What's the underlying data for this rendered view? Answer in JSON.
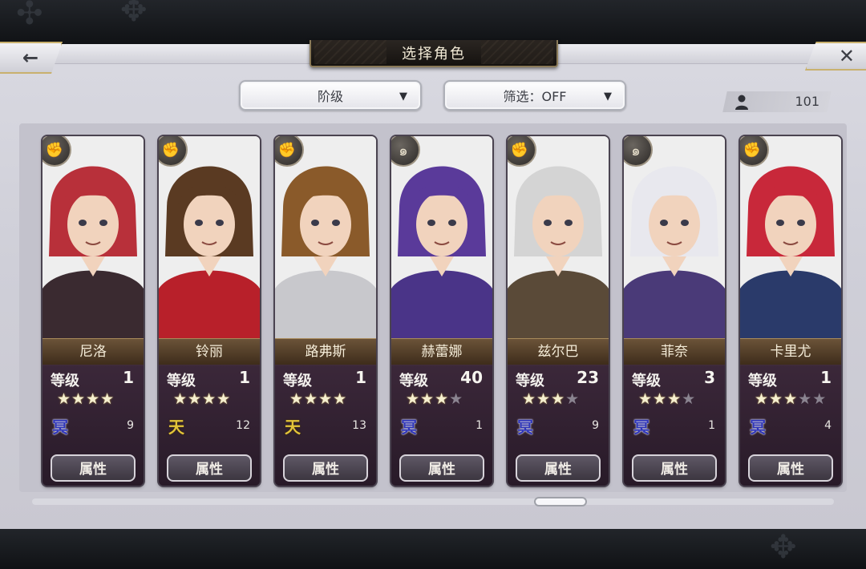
{
  "header": {
    "title": "选择角色",
    "back_icon": "←",
    "close_icon": "✕"
  },
  "filters": {
    "rank_label": "阶级",
    "filter_label": "筛选：OFF",
    "arrow": "▼"
  },
  "roster": {
    "count": "101"
  },
  "common": {
    "level_label": "等级",
    "attr_label": "属性"
  },
  "characters": [
    {
      "name": "尼洛",
      "level": "1",
      "stars": 4,
      "max_stars": 4,
      "tier": "冥",
      "tier_color": "#3036b8",
      "tier_count": "9",
      "class_icon": "fist-icon",
      "hair": "#b8303a",
      "outfit": "#3a2a30"
    },
    {
      "name": "铃丽",
      "level": "1",
      "stars": 4,
      "max_stars": 4,
      "tier": "天",
      "tier_color": "#e3c43a",
      "tier_count": "12",
      "class_icon": "fist-icon",
      "hair": "#5a3a22",
      "outfit": "#b8202a"
    },
    {
      "name": "路弗斯",
      "level": "1",
      "stars": 4,
      "max_stars": 4,
      "tier": "天",
      "tier_color": "#e3c43a",
      "tier_count": "13",
      "class_icon": "fist-icon",
      "hair": "#8a5a2a",
      "outfit": "#c8c8cc"
    },
    {
      "name": "赫蕾娜",
      "level": "40",
      "stars": 3,
      "max_stars": 4,
      "tier": "冥",
      "tier_color": "#3036b8",
      "tier_count": "1",
      "class_icon": "swirl-icon",
      "hair": "#5a3a9a",
      "outfit": "#4a3488"
    },
    {
      "name": "兹尔巴",
      "level": "23",
      "stars": 3,
      "max_stars": 4,
      "tier": "冥",
      "tier_color": "#3036b8",
      "tier_count": "9",
      "class_icon": "fist-icon",
      "hair": "#d4d4d4",
      "outfit": "#5a4a38"
    },
    {
      "name": "菲奈",
      "level": "3",
      "stars": 3,
      "max_stars": 4,
      "tier": "冥",
      "tier_color": "#3036b8",
      "tier_count": "1",
      "class_icon": "swirl-icon",
      "hair": "#e8e8ee",
      "outfit": "#4a3a78"
    },
    {
      "name": "卡里尤",
      "level": "1",
      "stars": 3,
      "max_stars": 5,
      "tier": "冥",
      "tier_color": "#3036b8",
      "tier_count": "4",
      "class_icon": "fist-icon",
      "hair": "#c8283a",
      "outfit": "#2a3a6a"
    }
  ]
}
